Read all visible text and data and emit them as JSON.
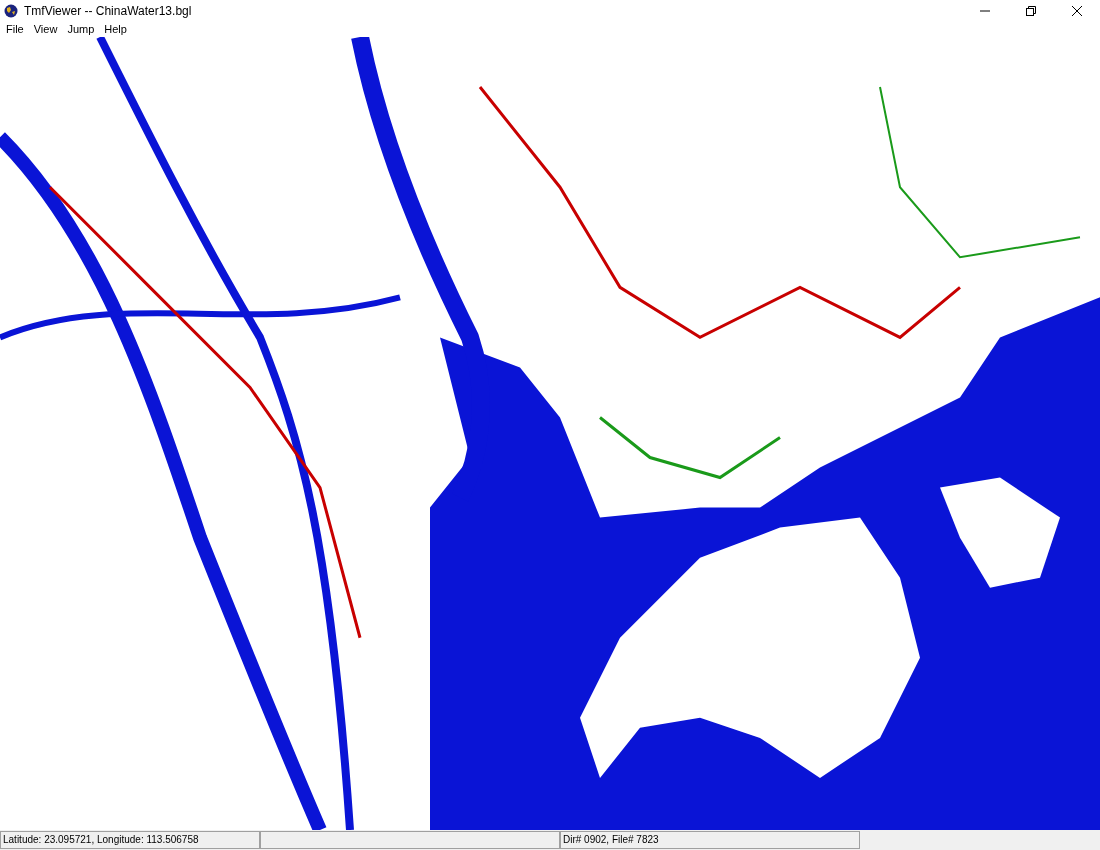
{
  "window": {
    "title": "TmfViewer -- ChinaWater13.bgl"
  },
  "menu": [
    "File",
    "View",
    "Jump",
    "Help"
  ],
  "status_bar": [
    "Latitude: 23.095721, Longitude: 113.506758",
    "Dir# 0902, File# 7823"
  ]
}
